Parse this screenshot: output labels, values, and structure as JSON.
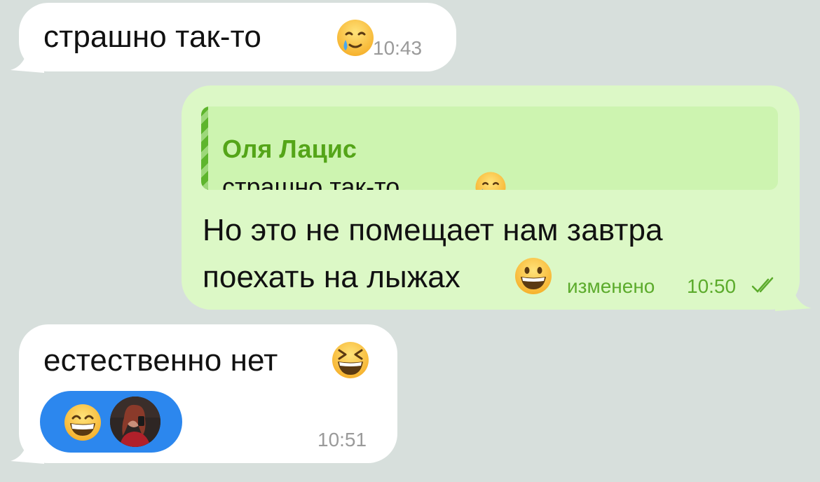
{
  "colors": {
    "chat_background": "#d7dfdc",
    "incoming_bubble": "#ffffff",
    "outgoing_bubble": "#dcf8c6",
    "reply_accent": "#54a518",
    "reaction_pill": "#2c87ee"
  },
  "messages": [
    {
      "direction": "incoming",
      "text": "страшно так-то",
      "emoji_icon": "crying-smile-emoji",
      "time": "10:43"
    },
    {
      "direction": "outgoing",
      "reply": {
        "sender": "Оля Лацис",
        "text": "страшно так-то",
        "emoji_icon": "crying-smile-emoji"
      },
      "line1": "Но это не помещает нам завтра",
      "line2": "поехать на лыжах",
      "emoji_icon": "grinning-emoji",
      "edited_label": "изменено",
      "time": "10:50",
      "status_icon": "double-check-icon"
    },
    {
      "direction": "incoming",
      "text": "естественно нет",
      "emoji_icon": "laughing-squint-emoji",
      "reaction": {
        "emoji_icon": "grinning-emoji",
        "avatar_icon": "user-avatar"
      },
      "time": "10:51"
    }
  ]
}
